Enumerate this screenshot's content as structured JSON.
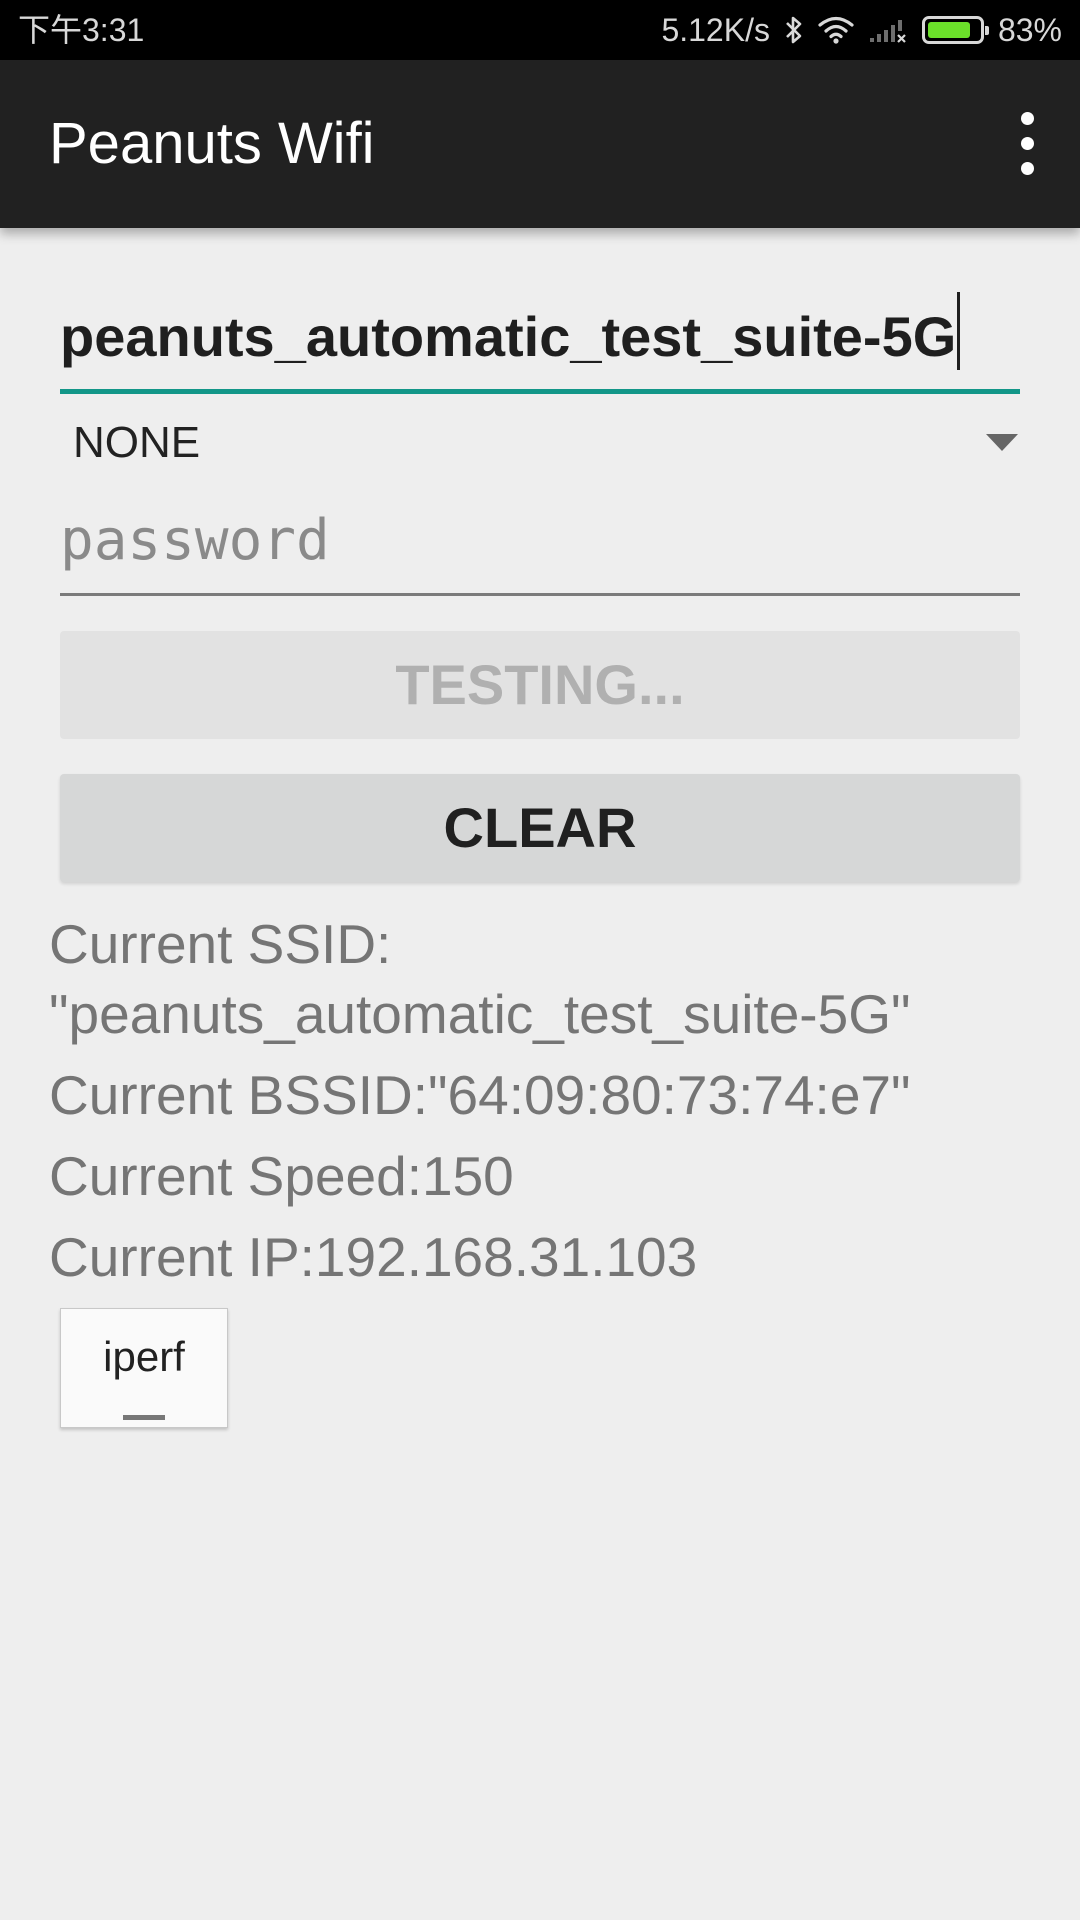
{
  "status_bar": {
    "time": "下午3:31",
    "network_speed": "5.12K/s",
    "battery_percent": "83%",
    "battery_level": 0.83,
    "icons": [
      "bluetooth-icon",
      "wifi-icon",
      "cell-signal-no-service-icon",
      "battery-icon"
    ]
  },
  "app_bar": {
    "title": "Peanuts Wifi",
    "menu_icon": "overflow-menu-icon"
  },
  "form": {
    "ssid_value": "peanuts_automatic_test_suite-5G",
    "security_selected": "NONE",
    "password_placeholder": "password",
    "password_value": "",
    "testing_label": "TESTING...",
    "clear_label": "CLEAR"
  },
  "info": {
    "ssid_line1": "Current SSID:",
    "ssid_line2": "\"peanuts_automatic_test_suite-5G\"",
    "bssid": "Current BSSID:\"64:09:80:73:74:e7\"",
    "speed": "Current Speed:150",
    "ip": "Current IP:192.168.31.103"
  },
  "iperf": {
    "label": "iperf"
  },
  "colors": {
    "accent": "#129688",
    "app_bar": "#212121",
    "battery": "#6be02a"
  }
}
